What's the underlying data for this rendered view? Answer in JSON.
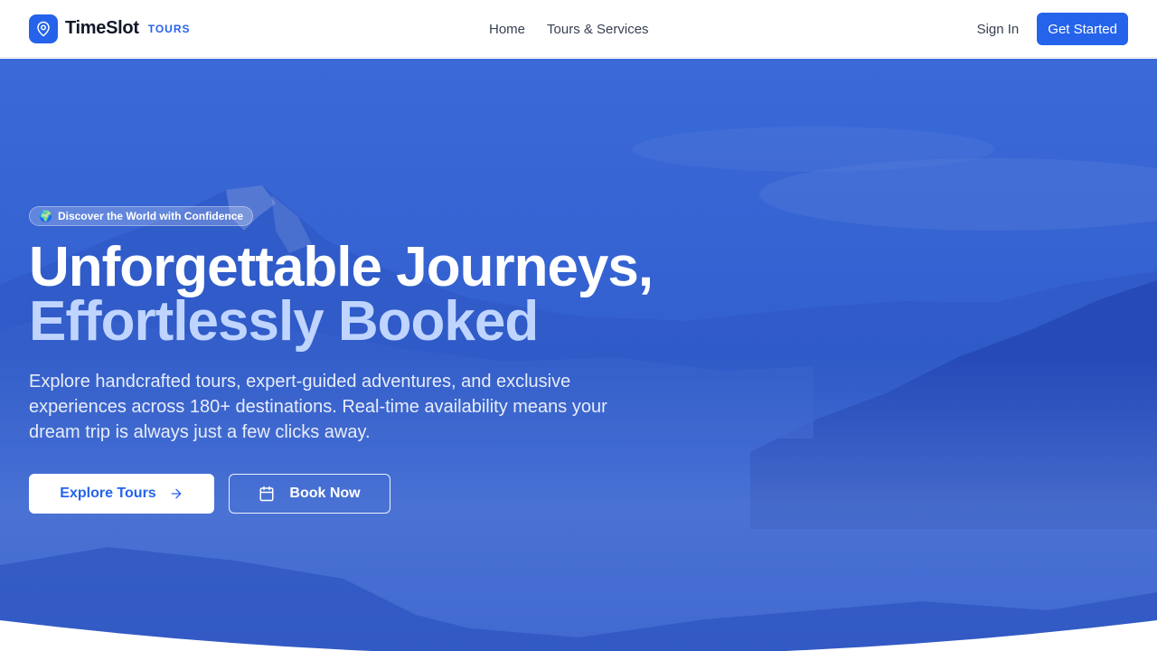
{
  "header": {
    "brand_name": "TimeSlot",
    "brand_tag": "TOURS",
    "brand_icon": "map-pin-icon",
    "nav": [
      {
        "label": "Home"
      },
      {
        "label": "Tours & Services"
      }
    ],
    "sign_in": "Sign In",
    "get_started": "Get Started"
  },
  "hero": {
    "badge_icon": "🌍",
    "badge_text": "Discover the World with Confidence",
    "headline_line1": "Unforgettable Journeys,",
    "headline_line2": "Effortlessly Booked",
    "subtext": "Explore handcrafted tours, expert-guided adventures, and exclusive experiences across 180+ destinations. Real-time availability means your dream trip is always just a few clicks away.",
    "explore_button": "Explore Tours",
    "book_button": "Book Now"
  },
  "colors": {
    "accent": "#2563eb",
    "hero_overlay": "#3360d4",
    "headline_highlight": "#bfd5ff"
  }
}
